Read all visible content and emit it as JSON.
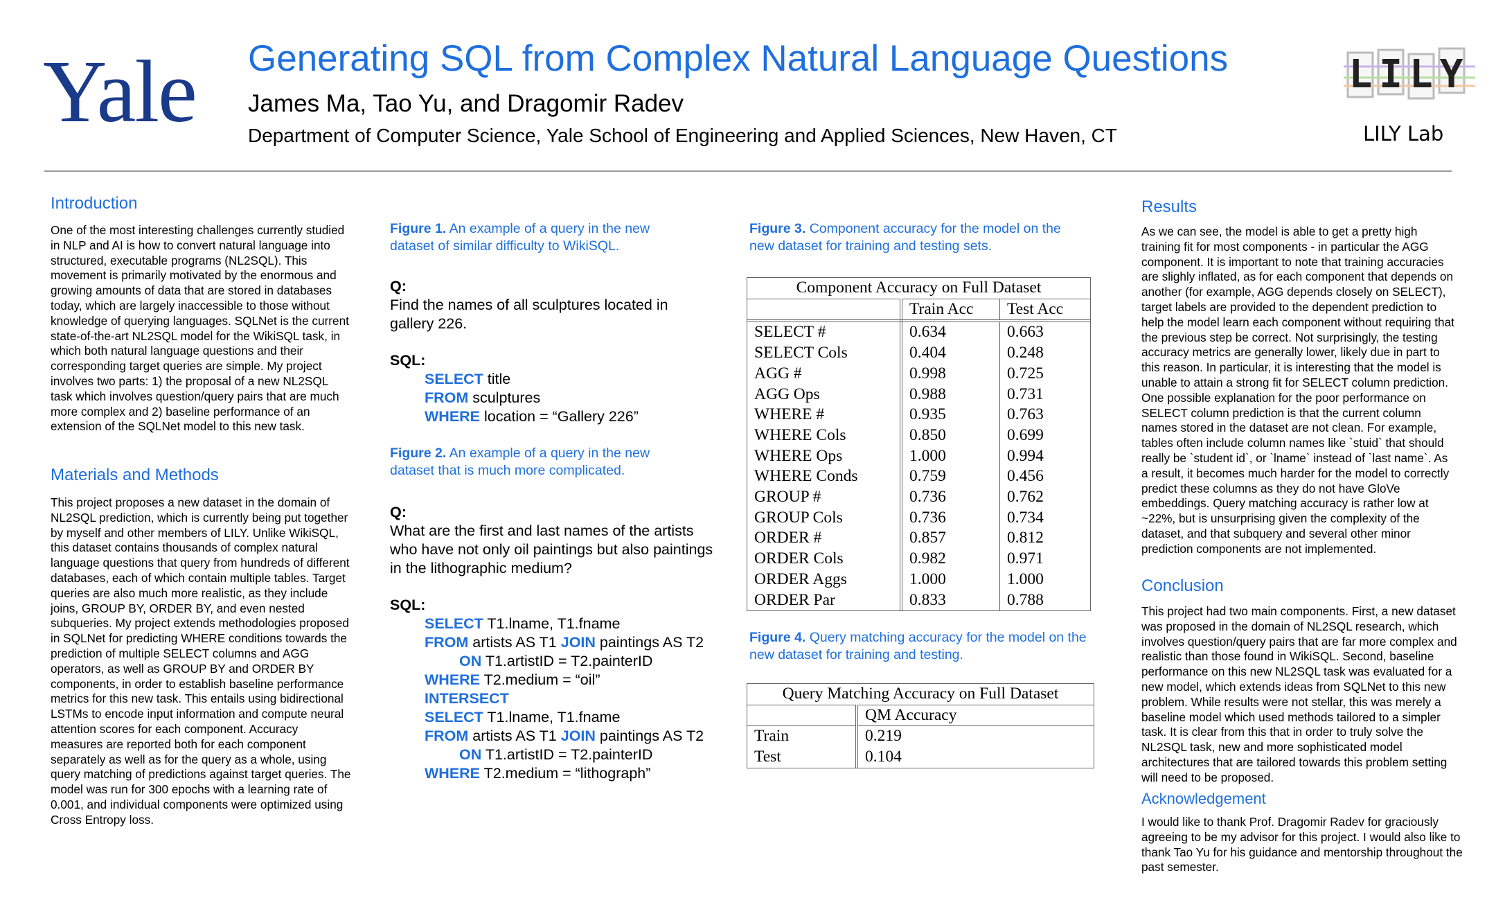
{
  "header": {
    "institution_logo": "Yale",
    "title": "Generating SQL from Complex Natural Language Questions",
    "authors": "James Ma, Tao Yu, and Dragomir Radev",
    "affiliation": "Department of Computer Science, Yale School of Engineering and Applied Sciences, New Haven, CT",
    "lab_logo_text": "LILY",
    "lab_label": "LILY Lab"
  },
  "introduction": {
    "heading": "Introduction",
    "body": "One of the most interesting challenges currently studied in NLP and AI is how to convert natural language into structured, executable programs (NL2SQL). This movement is primarily motivated by the enormous and growing amounts of data that are stored in databases today, which are largely inaccessible to those without knowledge of querying languages. SQLNet is the current state-of-the-art NL2SQL model for the WikiSQL task, in which both natural language questions and their corresponding target queries are simple. My project involves two parts: 1) the proposal of a new NL2SQL task which involves question/query pairs that are much more complex and 2) baseline performance of an extension of the SQLNet model to this new task."
  },
  "methods": {
    "heading": "Materials and Methods",
    "body": "This project proposes a new dataset in the domain of NL2SQL prediction, which is currently being put together by myself and other members of LILY. Unlike WikiSQL, this dataset contains thousands of complex natural language questions that query from hundreds of different databases, each of which contain multiple tables. Target queries are also much more realistic, as they include joins, GROUP BY, ORDER BY, and even nested subqueries. My project extends methodologies proposed in SQLNet for predicting WHERE conditions towards the prediction of multiple SELECT columns and AGG operators, as well as GROUP BY and ORDER BY components, in order to establish baseline performance metrics for this new task. This entails using bidirectional LSTMs to encode input information and compute neural attention scores for each component. Accuracy measures are reported both for each component separately as well as for the query as a whole, using query matching of predictions against target queries. The model was run for 300 epochs with a learning rate of 0.001, and individual components were optimized using Cross Entropy loss."
  },
  "figure1": {
    "label": "Figure 1.",
    "caption": "An example of a query in the new dataset of similar difficulty to WikiSQL.",
    "q_label": "Q:",
    "question": "Find the names of all sculptures located in gallery 226.",
    "sql_label": "SQL:",
    "sql": [
      {
        "kw": "SELECT",
        "rest": " title",
        "indent": 1
      },
      {
        "kw": "FROM",
        "rest": " sculptures",
        "indent": 1
      },
      {
        "kw": "WHERE",
        "rest": " location = “Gallery 226”",
        "indent": 1
      }
    ]
  },
  "figure2": {
    "label": "Figure 2.",
    "caption": "An example of a query in the new dataset that is much more complicated.",
    "q_label": "Q:",
    "question": "What are the first and last names of the artists who have not only oil paintings but also paintings in the lithographic medium?",
    "sql_label": "SQL:",
    "sql": [
      {
        "kw": "SELECT",
        "rest": " T1.lname, T1.fname",
        "indent": 1
      },
      {
        "kw": "FROM",
        "rest": " artists AS T1 ",
        "kw2": "JOIN",
        "rest2": " paintings AS T2",
        "indent": 1
      },
      {
        "kw": "ON",
        "rest": " T1.artistID = T2.painterID",
        "indent": 2
      },
      {
        "kw": "WHERE",
        "rest": " T2.medium = “oil”",
        "indent": 1
      },
      {
        "kw": "INTERSECT",
        "rest": "",
        "indent": 1
      },
      {
        "kw": "SELECT",
        "rest": " T1.lname, T1.fname",
        "indent": 1
      },
      {
        "kw": "FROM",
        "rest": " artists AS T1 ",
        "kw2": "JOIN",
        "rest2": " paintings AS T2",
        "indent": 1
      },
      {
        "kw": "ON",
        "rest": " T1.artistID = T2.painterID",
        "indent": 2
      },
      {
        "kw": "WHERE",
        "rest": " T2.medium = “lithograph”",
        "indent": 1
      }
    ]
  },
  "figure3": {
    "label": "Figure 3.",
    "caption": "Component accuracy for the model on the new dataset for training and testing sets.",
    "table_title": "Component Accuracy on Full Dataset",
    "col_headers": [
      "",
      "Train Acc",
      "Test Acc"
    ],
    "rows": [
      [
        "SELECT #",
        "0.634",
        "0.663"
      ],
      [
        "SELECT Cols",
        "0.404",
        "0.248"
      ],
      [
        "AGG #",
        "0.998",
        "0.725"
      ],
      [
        "AGG Ops",
        "0.988",
        "0.731"
      ],
      [
        "WHERE #",
        "0.935",
        "0.763"
      ],
      [
        "WHERE Cols",
        "0.850",
        "0.699"
      ],
      [
        "WHERE Ops",
        "1.000",
        "0.994"
      ],
      [
        "WHERE Conds",
        "0.759",
        "0.456"
      ],
      [
        "GROUP #",
        "0.736",
        "0.762"
      ],
      [
        "GROUP Cols",
        "0.736",
        "0.734"
      ],
      [
        "ORDER #",
        "0.857",
        "0.812"
      ],
      [
        "ORDER Cols",
        "0.982",
        "0.971"
      ],
      [
        "ORDER Aggs",
        "1.000",
        "1.000"
      ],
      [
        "ORDER Par",
        "0.833",
        "0.788"
      ]
    ]
  },
  "figure4": {
    "label": "Figure 4.",
    "caption": "Query matching accuracy for the model on the new dataset for training and testing.",
    "table_title": "Query Matching Accuracy on Full Dataset",
    "col_headers": [
      "",
      "QM Accuracy"
    ],
    "rows": [
      [
        "Train",
        "0.219"
      ],
      [
        "Test",
        "0.104"
      ]
    ]
  },
  "results": {
    "heading": "Results",
    "body": "As we can see, the model is able to get a pretty high training fit for most components - in particular the AGG component. It is important to note that training accuracies are slighly inflated, as for each component that depends on another (for example, AGG depends closely on SELECT), target labels are provided to the dependent prediction to help the model learn each component without requiring that the previous step be correct. Not surprisingly, the testing accuracy metrics are generally lower, likely due in part to this reason. In particular, it is interesting that the model is unable to attain a strong fit for SELECT column prediction. One possible explanation for the poor performance on SELECT column prediction is that the current column names stored in the dataset are not clean. For example, tables often include column names like `stuid` that should really be `student id`, or `lname` instead of `last name`. As a result, it becomes much harder for the model to correctly predict these columns as they do not have GloVe embeddings. Query matching accuracy is rather low at ~22%, but is unsurprising given the complexity of the dataset, and that subquery and several other minor prediction components are not implemented."
  },
  "conclusion": {
    "heading": "Conclusion",
    "body": "This project had two main components. First, a new dataset was proposed in the domain of NL2SQL research, which involves question/query pairs that are far more complex and realistic than those found in WikiSQL. Second, baseline performance on this new NL2SQL task was evaluated for a new model, which extends ideas from SQLNet to this new problem. While results were not stellar, this was merely a baseline model which used methods tailored to a simpler task. It is clear from this that in order to truly solve the NL2SQL task, new and more sophisticated model architectures that are tailored towards this problem setting will need to be proposed."
  },
  "acknowledgement": {
    "heading": "Acknowledgement",
    "body": "I would like to thank Prof. Dragomir Radev for graciously agreeing to be my advisor for this project. I would also like to thank Tao Yu for his guidance and mentorship throughout the past semester."
  },
  "colors": {
    "accent": "#1f6fdd",
    "yale_blue": "#1a3a8a"
  }
}
